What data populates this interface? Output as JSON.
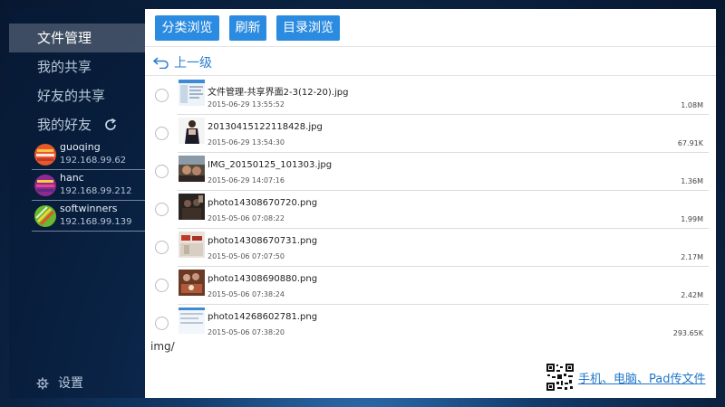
{
  "sidebar": {
    "nav": [
      {
        "label": "文件管理"
      },
      {
        "label": "我的共享"
      },
      {
        "label": "好友的共享"
      },
      {
        "label": "我的好友"
      }
    ],
    "friends": [
      {
        "name": "guoqing",
        "ip": "192.168.99.62"
      },
      {
        "name": "hanc",
        "ip": "192.168.99.212"
      },
      {
        "name": "softwinners",
        "ip": "192.168.99.139"
      }
    ],
    "settings_label": "设置"
  },
  "toolbar": {
    "category_label": "分类浏览",
    "refresh_label": "刷新",
    "directory_label": "目录浏览"
  },
  "nav_up_label": "上一级",
  "files": [
    {
      "name": "文件管理-共享界面2-3(12-20).jpg",
      "date": "2015-06-29 13:55:52",
      "size": "1.08M"
    },
    {
      "name": "20130415122118428.jpg",
      "date": "2015-06-29 13:54:30",
      "size": "67.91K"
    },
    {
      "name": "IMG_20150125_101303.jpg",
      "date": "2015-06-29 14:07:16",
      "size": "1.36M"
    },
    {
      "name": "photo14308670720.png",
      "date": "2015-05-06 07:08:22",
      "size": "1.99M"
    },
    {
      "name": "photo14308670731.png",
      "date": "2015-05-06 07:07:50",
      "size": "2.17M"
    },
    {
      "name": "photo14308690880.png",
      "date": "2015-05-06 07:38:24",
      "size": "2.42M"
    },
    {
      "name": "photo14268602781.png",
      "date": "2015-05-06 07:38:20",
      "size": "293.65K"
    }
  ],
  "current_path": "img/",
  "transfer_link_label": "手机、电脑、Pad传文件",
  "colors": {
    "accent": "#2a8be0",
    "link": "#1f76c9"
  }
}
